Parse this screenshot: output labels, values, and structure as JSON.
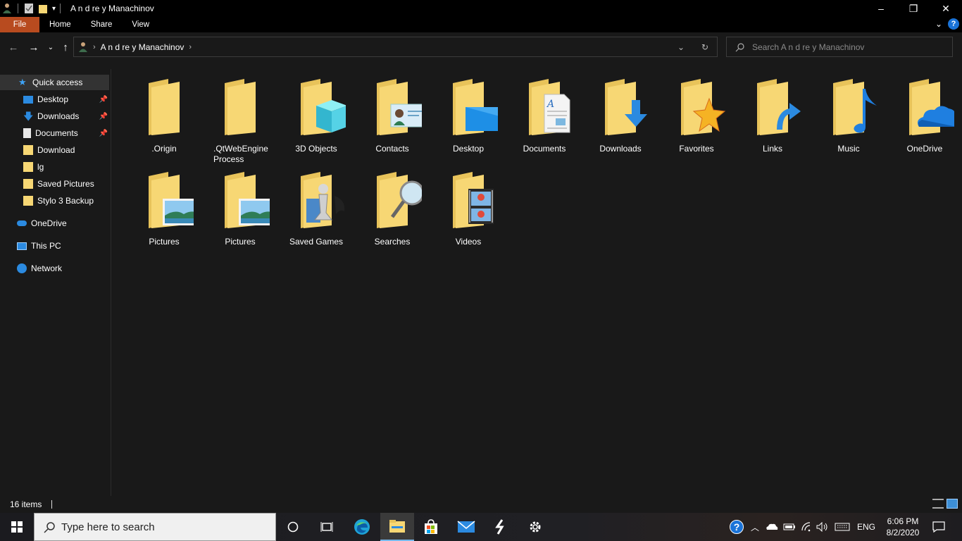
{
  "window": {
    "title": "A n d re y Manachinov"
  },
  "ribbon": {
    "tabs": [
      "File",
      "Home",
      "Share",
      "View"
    ]
  },
  "address": {
    "crumbs": [
      "A n d re y Manachinov"
    ],
    "search_placeholder": "Search A n d re y Manachinov"
  },
  "sidebar": {
    "items": [
      {
        "label": "Quick access",
        "icon": "star-icon",
        "selected": true
      },
      {
        "label": "Desktop",
        "icon": "desktop-icon",
        "pinned": true
      },
      {
        "label": "Downloads",
        "icon": "download-arrow-icon",
        "pinned": true
      },
      {
        "label": "Documents",
        "icon": "document-icon",
        "pinned": true
      },
      {
        "label": "Download",
        "icon": "folder-icon"
      },
      {
        "label": "lg",
        "icon": "folder-icon"
      },
      {
        "label": "Saved Pictures",
        "icon": "folder-icon"
      },
      {
        "label": "Stylo 3 Backup",
        "icon": "folder-icon"
      },
      {
        "label": "OneDrive",
        "icon": "cloud-icon"
      },
      {
        "label": "This PC",
        "icon": "computer-icon"
      },
      {
        "label": "Network",
        "icon": "network-icon"
      }
    ]
  },
  "folders": [
    {
      "label": ".Origin",
      "overlay": "none"
    },
    {
      "label": ".QtWebEngine Process",
      "overlay": "none"
    },
    {
      "label": "3D Objects",
      "overlay": "cube"
    },
    {
      "label": "Contacts",
      "overlay": "contact-card"
    },
    {
      "label": "Desktop",
      "overlay": "desktop"
    },
    {
      "label": "Documents",
      "overlay": "document"
    },
    {
      "label": "Downloads",
      "overlay": "download-arrow"
    },
    {
      "label": "Favorites",
      "overlay": "star"
    },
    {
      "label": "Links",
      "overlay": "link-arrow"
    },
    {
      "label": "Music",
      "overlay": "music-note"
    },
    {
      "label": "OneDrive",
      "overlay": "cloud"
    },
    {
      "label": "Pictures",
      "overlay": "landscape"
    },
    {
      "label": "Pictures",
      "overlay": "landscape"
    },
    {
      "label": "Saved Games",
      "overlay": "chess-piece"
    },
    {
      "label": "Searches",
      "overlay": "magnifier"
    },
    {
      "label": "Videos",
      "overlay": "film"
    }
  ],
  "status": {
    "item_count": "16 items"
  },
  "taskbar": {
    "search_placeholder": "Type here to search",
    "tray_language": "ENG",
    "time": "6:06 PM",
    "date": "8/2/2020"
  },
  "colors": {
    "file_tab": "#b84b1f",
    "folder_yellow": "#f7d774",
    "accent_blue": "#1a73d8"
  }
}
